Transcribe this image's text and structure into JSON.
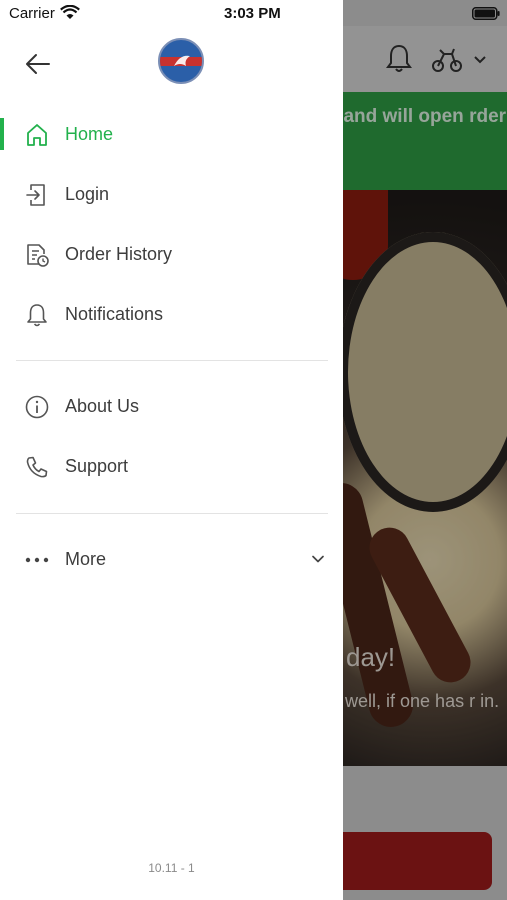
{
  "status_bar": {
    "carrier": "Carrier",
    "time": "3:03 PM"
  },
  "background": {
    "banner_text": "ed and will open rder now for",
    "banner_color": "#2f9c45",
    "hero_title": "day!",
    "hero_subtitle": "o well, if one has r in.",
    "icons": [
      "bell-icon",
      "scooter-icon",
      "chevron-down-icon"
    ]
  },
  "drawer": {
    "back_icon": "arrow-left-icon",
    "logo": "restaurant-logo",
    "menu": [
      {
        "label": "Home",
        "icon": "home-icon",
        "active": true
      },
      {
        "label": "Login",
        "icon": "login-icon",
        "active": false
      },
      {
        "label": "Order History",
        "icon": "receipt-clock-icon",
        "active": false
      },
      {
        "label": "Notifications",
        "icon": "bell-icon",
        "active": false
      }
    ],
    "secondary_menu": [
      {
        "label": "About Us",
        "icon": "info-icon"
      },
      {
        "label": "Support",
        "icon": "phone-icon"
      }
    ],
    "more": {
      "label": "More",
      "icon": "more-dots-icon",
      "expand_icon": "chevron-down-icon"
    },
    "version": "10.11 - 1",
    "accent_color": "#22b14c"
  }
}
